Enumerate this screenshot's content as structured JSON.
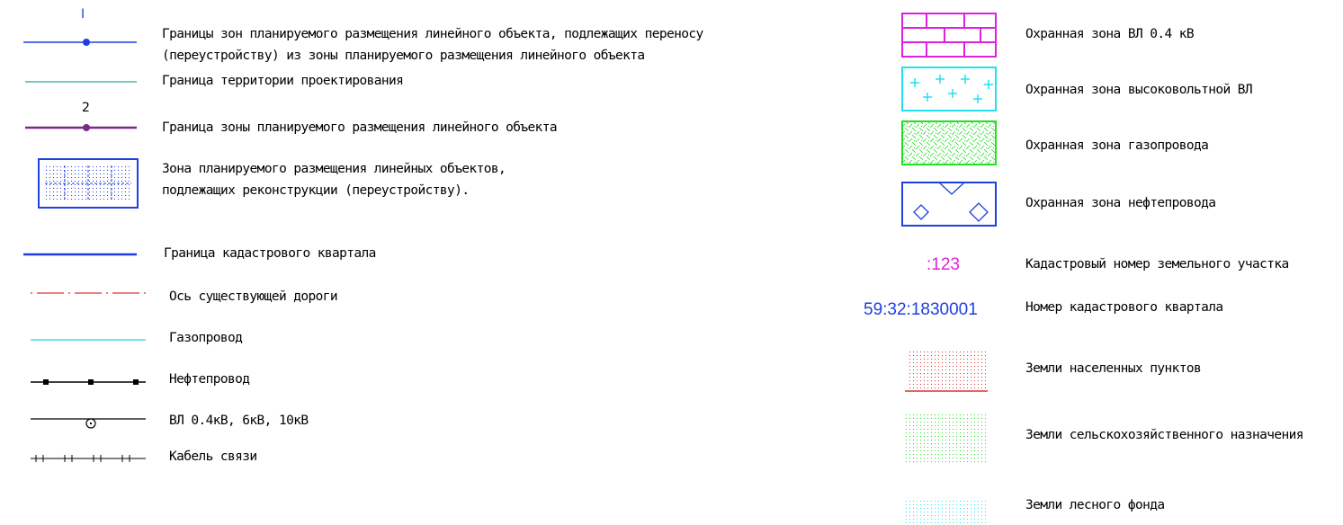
{
  "legend_left": [
    {
      "symbol": "zone-transfer-line",
      "marker": "I",
      "label_lines": [
        "Границы зон планируемого размещения линейного объекта, подлежащих переносу",
        "(переустройству) из зоны планируемого размещения линейного объекта"
      ],
      "color": "#1f3fe0"
    },
    {
      "symbol": "design-territory-boundary",
      "label_lines": [
        "Граница территории проектирования"
      ],
      "color": "#2aa39a"
    },
    {
      "symbol": "zone-boundary-line",
      "marker": "2",
      "label_lines": [
        "Граница зоны планируемого размещения линейного объекта"
      ],
      "color": "#7a2a8c"
    },
    {
      "symbol": "reconstruction-zone-fill",
      "label_lines": [
        "Зона планируемого размещения линейных объектов,",
        "подлежащих реконструкции (переустройству)."
      ],
      "color": "#1f3fe0"
    },
    {
      "symbol": "cadastral-quarter-boundary",
      "label_lines": [
        "Граница кадастрового квартала"
      ],
      "color": "#1f3fe0"
    },
    {
      "symbol": "road-axis",
      "label_lines": [
        "Ось существующей дороги"
      ],
      "color": "#e03030"
    },
    {
      "symbol": "gas-pipeline",
      "label_lines": [
        "Газопровод"
      ],
      "color": "#22d3e0"
    },
    {
      "symbol": "oil-pipeline",
      "label_lines": [
        "Нефтепровод"
      ],
      "color": "#000000"
    },
    {
      "symbol": "power-line",
      "label_lines": [
        "ВЛ 0.4кВ, 6кВ, 10кВ"
      ],
      "color": "#000000"
    },
    {
      "symbol": "communication-cable",
      "label_lines": [
        "Кабель связи"
      ],
      "color": "#000000"
    }
  ],
  "legend_right": [
    {
      "symbol": "vl04-protection-zone",
      "label": "Охранная зона ВЛ 0.4 кВ",
      "color": "#e020e0"
    },
    {
      "symbol": "hv-protection-zone",
      "label": "Охранная зона высоковольтной ВЛ",
      "color": "#22e0f0"
    },
    {
      "symbol": "gas-protection-zone",
      "label": "Охранная зона газопровода",
      "color": "#22e022"
    },
    {
      "symbol": "oil-protection-zone",
      "label": "Охранная зона нефтепровода",
      "color": "#1f3fe0"
    },
    {
      "symbol": "land-plot-number",
      "code": ":123",
      "label": "Кадастровый номер земельного участка",
      "color": "#e020e0"
    },
    {
      "symbol": "cadastral-quarter-number",
      "code": "59:32:1830001",
      "label": "Номер кадастрового квартала",
      "color": "#1f3fe0"
    },
    {
      "symbol": "settlement-lands",
      "label": "Земли населенных пунктов",
      "color": "#e03030"
    },
    {
      "symbol": "agricultural-lands",
      "label": "Земли сельскохозяйственного назначения",
      "color": "#22e022"
    },
    {
      "symbol": "forest-lands",
      "label": "Земли лесного фонда",
      "color": "#22e0f0"
    }
  ]
}
